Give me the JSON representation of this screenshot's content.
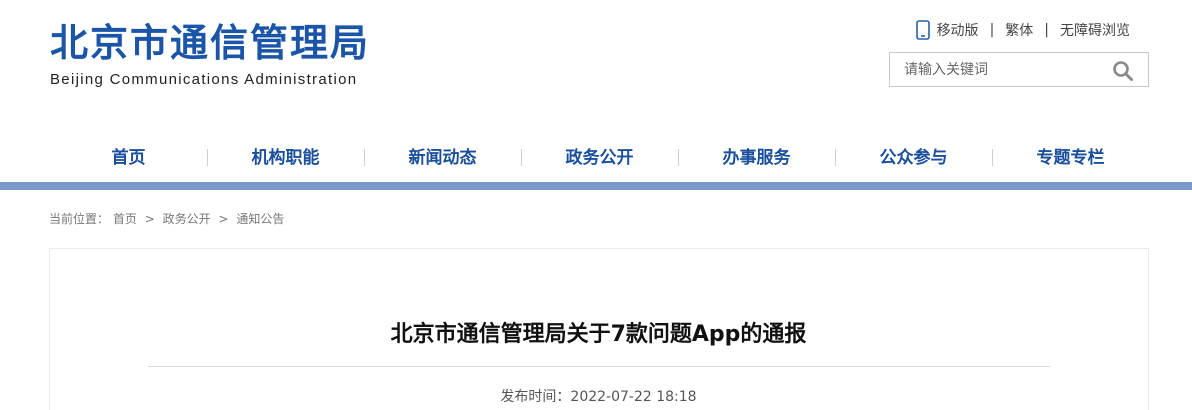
{
  "header": {
    "title_cn": "北京市通信管理局",
    "title_en": "Beijing Communications Administration",
    "links": [
      "移动版",
      "繁体",
      "无障碍浏览"
    ],
    "link_sep": "|",
    "search_placeholder": "请输入关键词"
  },
  "nav": {
    "items": [
      "首页",
      "机构职能",
      "新闻动态",
      "政务公开",
      "办事服务",
      "公众参与",
      "专题专栏"
    ]
  },
  "breadcrumb": {
    "prefix": "当前位置：",
    "items": [
      "首页",
      "政务公开",
      "通知公告"
    ],
    "sep": ">"
  },
  "article": {
    "title": "北京市通信管理局关于7款问题App的通报",
    "publish_label": "发布时间：",
    "publish_time": "2022-07-22 18:18"
  },
  "colors": {
    "brand_blue": "#1a55a8",
    "nav_bar": "#7a9bc9"
  },
  "icons": {
    "mobile": "mobile-phone-icon",
    "search": "magnifier-icon"
  }
}
